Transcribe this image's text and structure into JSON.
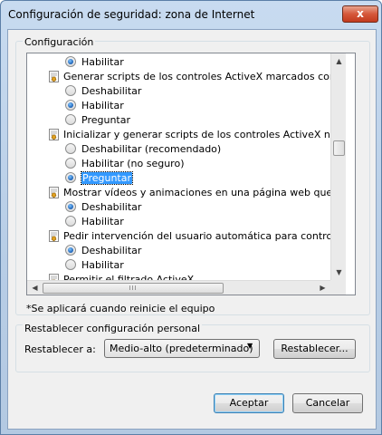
{
  "window": {
    "title": "Configuración de seguridad: zona de Internet",
    "close_glyph": "x"
  },
  "settings_group": {
    "label": "Configuración",
    "rows": [
      {
        "kind": "option",
        "label": "Habilitar",
        "checked": true
      },
      {
        "kind": "category",
        "label": "Generar scripts de los controles ActiveX marcados como segu",
        "icon": "settings-shield-icon"
      },
      {
        "kind": "option",
        "label": "Deshabilitar",
        "checked": false
      },
      {
        "kind": "option",
        "label": "Habilitar",
        "checked": true
      },
      {
        "kind": "option",
        "label": "Preguntar",
        "checked": false
      },
      {
        "kind": "category",
        "label": "Inicializar y generar scripts de los controles ActiveX no marca",
        "icon": "settings-shield-icon"
      },
      {
        "kind": "option",
        "label": "Deshabilitar (recomendado)",
        "checked": false
      },
      {
        "kind": "option",
        "label": "Habilitar (no seguro)",
        "checked": false
      },
      {
        "kind": "option",
        "label": "Preguntar",
        "checked": true,
        "selected": true
      },
      {
        "kind": "category",
        "label": "Mostrar vídeos y animaciones en una página web que no usa",
        "icon": "settings-shield-icon"
      },
      {
        "kind": "option",
        "label": "Deshabilitar",
        "checked": true
      },
      {
        "kind": "option",
        "label": "Habilitar",
        "checked": false
      },
      {
        "kind": "category",
        "label": "Pedir intervención del usuario automática para controles Acti",
        "icon": "settings-shield-icon"
      },
      {
        "kind": "option",
        "label": "Deshabilitar",
        "checked": true
      },
      {
        "kind": "option",
        "label": "Habilitar",
        "checked": false
      },
      {
        "kind": "category",
        "label": "Permitir el filtrado ActiveX",
        "icon": "settings-shield-icon"
      }
    ],
    "restart_note": "*Se aplicará cuando reinicie el equipo"
  },
  "reset_group": {
    "label": "Restablecer configuración personal",
    "reset_to_label": "Restablecer a:",
    "level_value": "Medio-alto (predeterminado)",
    "reset_button": "Restablecer..."
  },
  "buttons": {
    "ok": "Aceptar",
    "cancel": "Cancelar"
  },
  "colors": {
    "selection": "#3399ff",
    "window_frame": "#b7cde6",
    "close_button": "#d5573a"
  }
}
